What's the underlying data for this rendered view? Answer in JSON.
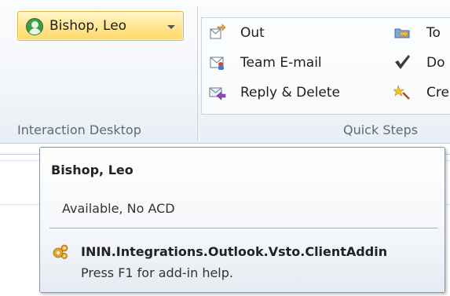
{
  "ribbon": {
    "status_button": {
      "label": "Bishop, Leo",
      "status_color": "#3e9a4c"
    },
    "groups": {
      "interaction_desktop": "Interaction Desktop",
      "quick_steps": "Quick Steps"
    },
    "quick_steps": {
      "col1": [
        {
          "label": "Out",
          "icon": "mail-forward-icon"
        },
        {
          "label": "Team E-mail",
          "icon": "team-email-icon"
        },
        {
          "label": "Reply & Delete",
          "icon": "reply-delete-icon"
        }
      ],
      "col2": [
        {
          "label": "To",
          "icon": "move-to-folder-icon"
        },
        {
          "label": "Do",
          "icon": "done-check-icon"
        },
        {
          "label": "Cre",
          "icon": "create-new-icon"
        }
      ]
    }
  },
  "tooltip": {
    "title": "Bishop, Leo",
    "status": "Available, No ACD",
    "addin_name": "ININ.Integrations.Outlook.Vsto.ClientAddin",
    "help_text": "Press F1 for add-in help."
  }
}
